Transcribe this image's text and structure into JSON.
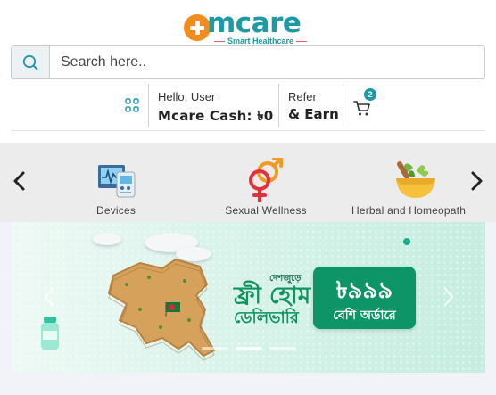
{
  "brand": {
    "logo_text": "mcare",
    "tagline": "Smart Healthcare",
    "primary_color": "#1c9aa5",
    "accent_color": "#f28c1e"
  },
  "search": {
    "placeholder": "Search here..",
    "icon": "search-icon"
  },
  "account": {
    "greeting": "Hello, User",
    "cash_label": "Mcare Cash: ৳0",
    "refer_line1": "Refer",
    "refer_line2": "& Earn",
    "menu_icon": "grid-icon",
    "cart_icon": "cart-icon",
    "cart_count": "2"
  },
  "categories": {
    "items": [
      {
        "label": "Devices",
        "icon": "devices-icon"
      },
      {
        "label": "Sexual Wellness",
        "icon": "gender-symbols-icon"
      },
      {
        "label": "Herbal and Homeopath",
        "icon": "mortar-herbs-icon"
      }
    ],
    "prev_icon": "chevron-left-icon",
    "next_icon": "chevron-right-icon"
  },
  "banner": {
    "small_text": "দেশজুড়ে",
    "headline_line1": "ফ্রী হোম",
    "headline_line2": "ডেলিভারি",
    "price": "৳৯৯৯",
    "min_order_text": "বেশি অর্ডারে",
    "background_color": "#d8f3ea",
    "highlight_color": "#0e9567",
    "active_slide": 1,
    "slide_count": 3
  }
}
